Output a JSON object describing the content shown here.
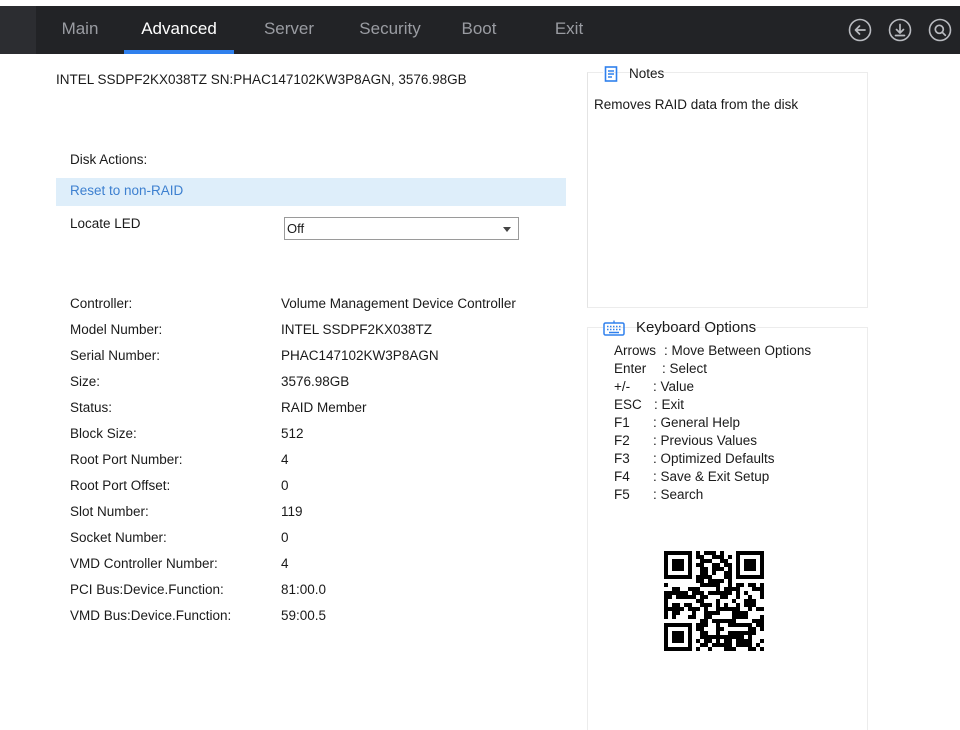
{
  "tabs": [
    {
      "label": "Main",
      "active": false
    },
    {
      "label": "Advanced",
      "active": true
    },
    {
      "label": "Server",
      "active": false
    },
    {
      "label": "Security",
      "active": false
    },
    {
      "label": "Boot",
      "active": false
    },
    {
      "label": "Exit",
      "active": false
    }
  ],
  "toolbar_icons": [
    "back-icon",
    "download-icon",
    "search-icon"
  ],
  "disk": {
    "title": "INTEL SSDPF2KX038TZ SN:PHAC147102KW3P8AGN, 3576.98GB",
    "actions_label": "Disk Actions:",
    "reset_label": "Reset to non-RAID",
    "locate_led_label": "Locate LED",
    "locate_led_value": "Off"
  },
  "properties": [
    {
      "label": "Controller:",
      "value": "Volume Management Device Controller"
    },
    {
      "label": "Model Number:",
      "value": "INTEL SSDPF2KX038TZ"
    },
    {
      "label": "Serial Number:",
      "value": "PHAC147102KW3P8AGN"
    },
    {
      "label": "Size:",
      "value": "3576.98GB"
    },
    {
      "label": "Status:",
      "value": "RAID Member"
    },
    {
      "label": "Block Size:",
      "value": "512"
    },
    {
      "label": "Root Port Number:",
      "value": "4"
    },
    {
      "label": "Root Port Offset:",
      "value": "0"
    },
    {
      "label": "Slot Number:",
      "value": "119"
    },
    {
      "label": "Socket Number:",
      "value": "0"
    },
    {
      "label": "VMD Controller Number:",
      "value": "4"
    },
    {
      "label": "PCI Bus:Device.Function:",
      "value": "81:00.0"
    },
    {
      "label": "VMD Bus:Device.Function:",
      "value": "59:00.5"
    }
  ],
  "notes": {
    "title": "Notes",
    "text": "Removes RAID data from the disk"
  },
  "keyboard": {
    "title": "Keyboard Options",
    "items": [
      {
        "key": "Arrows",
        "desc": ": Move Between Options"
      },
      {
        "key": "Enter",
        "desc": ": Select"
      },
      {
        "key": "+/-",
        "desc": ": Value"
      },
      {
        "key": "ESC",
        "desc": ": Exit"
      },
      {
        "key": "F1",
        "desc": ": General Help"
      },
      {
        "key": "F2",
        "desc": ": Previous Values"
      },
      {
        "key": "F3",
        "desc": ": Optimized Defaults"
      },
      {
        "key": "F4",
        "desc": ": Save & Exit Setup"
      },
      {
        "key": "F5",
        "desc": ": Search"
      }
    ]
  },
  "colors": {
    "topbar": "#222326",
    "accent": "#2f80ed",
    "highlight_row": "#deeefa",
    "link_text": "#3d80d0"
  }
}
